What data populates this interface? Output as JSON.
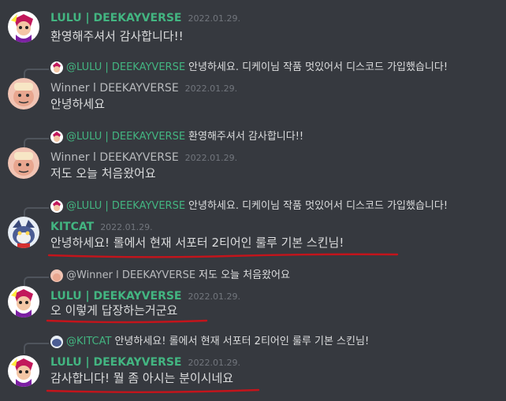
{
  "messages": [
    {
      "author": "LULU | DEEKAYVERSE",
      "timestamp": "2022.01.29.",
      "content": "환영해주셔서 감사합니다!!"
    },
    {
      "reply": {
        "author": "@LULU | DEEKAYVERSE",
        "text": "안녕하세요. 디케이님 작품 멋있어서 디스코드 가입했습니다!"
      },
      "author": "Winner l DEEKAYVERSE",
      "timestamp": "2022.01.29.",
      "content": "안녕하세요"
    },
    {
      "reply": {
        "author": "@LULU | DEEKAYVERSE",
        "text": "환영해주셔서 감사합니다!!"
      },
      "author": "Winner l DEEKAYVERSE",
      "timestamp": "2022.01.29.",
      "content": "저도 오늘 처음왔어요"
    },
    {
      "reply": {
        "author": "@LULU | DEEKAYVERSE",
        "text": "안녕하세요. 디케이님 작품 멋있어서 디스코드 가입했습니다!"
      },
      "author": "KITCAT",
      "timestamp": "2022.01.29.",
      "content": "안녕하세요! 롤에서 현재 서포터 2티어인 룰루 기본 스킨님!"
    },
    {
      "reply": {
        "author": "@Winner l DEEKAYVERSE",
        "text": "저도 오늘 처음왔어요"
      },
      "author": "LULU | DEEKAYVERSE",
      "timestamp": "2022.01.29.",
      "content": "오 이렇게 답장하는거군요"
    },
    {
      "reply": {
        "author": "@KITCAT",
        "text": "안녕하세요! 롤에서 현재 서포터 2티어인 룰루 기본 스킨님!"
      },
      "author": "LULU | DEEKAYVERSE",
      "timestamp": "2022.01.29.",
      "content": "감사합니다! 뭘 좀 아시는 분이시네요"
    }
  ],
  "colors": {
    "background": "#36393f",
    "username_green": "#43b581",
    "username_grey": "#b9bbbe",
    "underline_red": "#c4141b"
  }
}
